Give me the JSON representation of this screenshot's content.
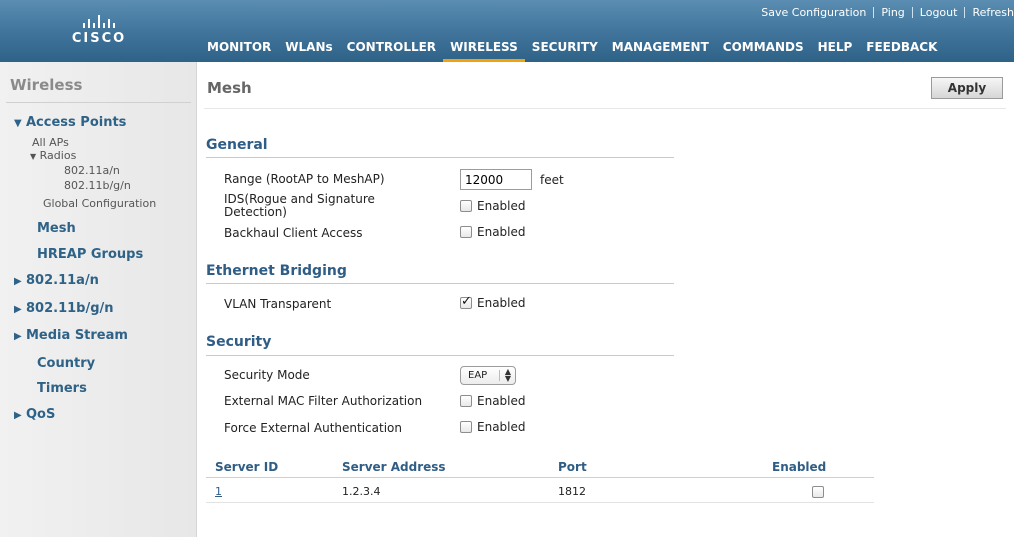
{
  "brand": {
    "logo_text": "CISCO"
  },
  "top_links": [
    "Save Configuration",
    "Ping",
    "Logout",
    "Refresh"
  ],
  "main_nav": [
    "MONITOR",
    "WLANs",
    "CONTROLLER",
    "WIRELESS",
    "SECURITY",
    "MANAGEMENT",
    "COMMANDS",
    "HELP",
    "FEEDBACK"
  ],
  "active_nav": "WIRELESS",
  "sidebar": {
    "title": "Wireless",
    "access_points": "Access Points",
    "all_aps": "All APs",
    "radios": "Radios",
    "radio_a": "802.11a/n",
    "radio_bg": "802.11b/g/n",
    "global_config": "Global Configuration",
    "mesh": "Mesh",
    "hreap": "HREAP Groups",
    "dot11a": "802.11a/n",
    "dot11bg": "802.11b/g/n",
    "media_stream": "Media Stream",
    "country": "Country",
    "timers": "Timers",
    "qos": "QoS"
  },
  "page": {
    "title": "Mesh",
    "apply_label": "Apply"
  },
  "general": {
    "heading": "General",
    "range_label": "Range (RootAP to MeshAP)",
    "range_value": "12000",
    "range_unit": "feet",
    "ids_label_1": "IDS(Rogue and Signature",
    "ids_label_2": "Detection)",
    "ids_enabled": false,
    "backhaul_label": "Backhaul Client Access",
    "backhaul_enabled": false,
    "enabled_text": "Enabled"
  },
  "ethernet": {
    "heading": "Ethernet Bridging",
    "vlan_label": "VLAN Transparent",
    "vlan_enabled": true,
    "enabled_text": "Enabled"
  },
  "security": {
    "heading": "Security",
    "mode_label": "Security Mode",
    "mode_value": "EAP",
    "mac_label": "External MAC Filter Authorization",
    "mac_enabled": false,
    "force_label": "Force External Authentication",
    "force_enabled": false,
    "enabled_text": "Enabled"
  },
  "servers": {
    "columns": [
      "Server ID",
      "Server Address",
      "Port",
      "Enabled"
    ],
    "rows": [
      {
        "id": "1",
        "address": "1.2.3.4",
        "port": "1812",
        "enabled": false
      }
    ]
  },
  "colors": {
    "header_blue": "#3f739a",
    "active_tab": "#f2a20b",
    "section_blue": "#2f5d85"
  }
}
